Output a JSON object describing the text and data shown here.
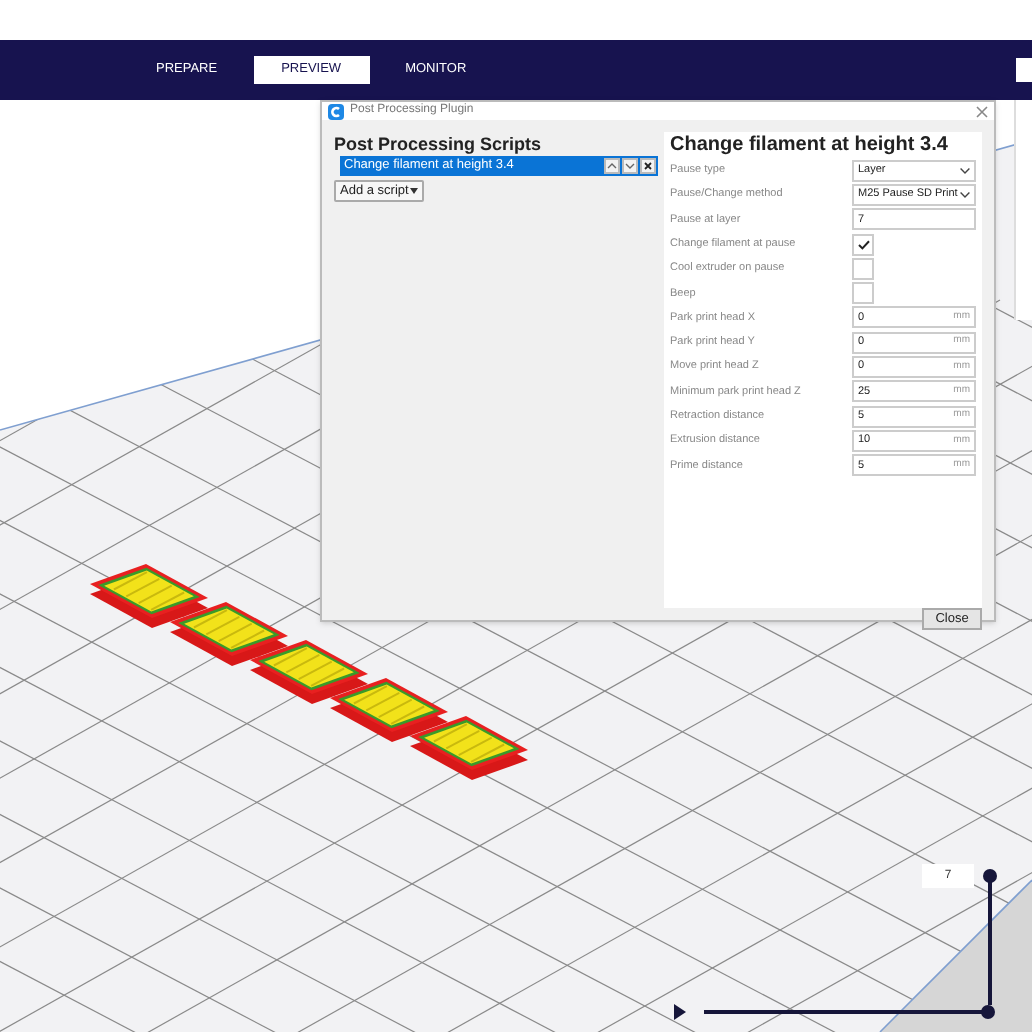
{
  "top_bar": {
    "tabs": [
      {
        "label": "PREPARE",
        "selected": false
      },
      {
        "label": "PREVIEW",
        "selected": true
      },
      {
        "label": "MONITOR",
        "selected": false
      }
    ]
  },
  "dialog": {
    "title": "Post Processing Plugin",
    "scripts_heading": "Post Processing Scripts",
    "scripts": [
      {
        "label": "Change filament at height 3.4",
        "selected": true
      }
    ],
    "add_button": "Add a script",
    "settings_heading": "Change filament at height 3.4",
    "settings": [
      {
        "kind": "dropdown",
        "label": "Pause type",
        "value": "Layer"
      },
      {
        "kind": "dropdown",
        "label": "Pause/Change method",
        "value": "M25 Pause SD Print"
      },
      {
        "kind": "text",
        "label": "Pause at layer",
        "value": "7"
      },
      {
        "kind": "checkbox",
        "label": "Change filament at pause",
        "checked": true
      },
      {
        "kind": "checkbox",
        "label": "Cool extruder on pause",
        "checked": false
      },
      {
        "kind": "checkbox",
        "label": "Beep",
        "checked": false
      },
      {
        "kind": "number",
        "label": "Park print head X",
        "value": "0",
        "unit": "mm"
      },
      {
        "kind": "number",
        "label": "Park print head Y",
        "value": "0",
        "unit": "mm"
      },
      {
        "kind": "number",
        "label": "Move print head Z",
        "value": "0",
        "unit": "mm"
      },
      {
        "kind": "number",
        "label": "Minimum park print head Z",
        "value": "25",
        "unit": "mm"
      },
      {
        "kind": "number",
        "label": "Retraction distance",
        "value": "5",
        "unit": "mm"
      },
      {
        "kind": "number",
        "label": "Extrusion distance",
        "value": "10",
        "unit": "mm"
      },
      {
        "kind": "number",
        "label": "Prime distance",
        "value": "5",
        "unit": "mm"
      }
    ],
    "close_button": "Close"
  },
  "layer_slider": {
    "value": "7",
    "level": 1
  },
  "horizontal_slider": {
    "level": 1
  }
}
